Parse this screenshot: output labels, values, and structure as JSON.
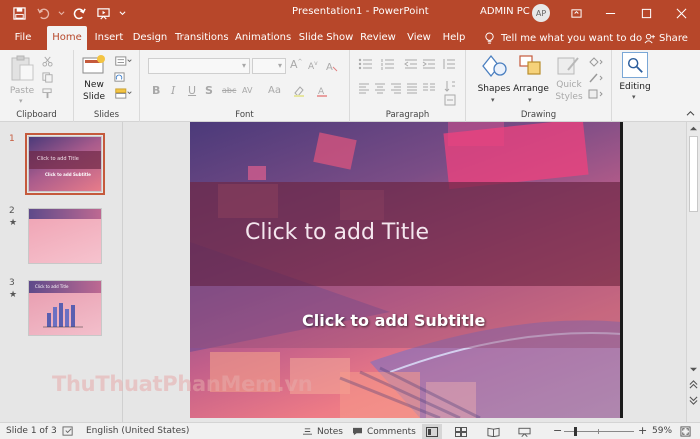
{
  "titlebar": {
    "title": "Presentation1 - PowerPoint",
    "user_name": "ADMIN PC",
    "avatar_initials": "AP"
  },
  "tabs": [
    {
      "label": "File"
    },
    {
      "label": "Home",
      "active": true
    },
    {
      "label": "Insert"
    },
    {
      "label": "Design"
    },
    {
      "label": "Transitions"
    },
    {
      "label": "Animations"
    },
    {
      "label": "Slide Show"
    },
    {
      "label": "Review"
    },
    {
      "label": "View"
    },
    {
      "label": "Help"
    }
  ],
  "tell_me": "Tell me what you want to do",
  "share": "Share",
  "ribbon": {
    "clipboard": {
      "label": "Clipboard",
      "paste": "Paste"
    },
    "slides": {
      "label": "Slides",
      "new_slide_1": "New",
      "new_slide_2": "Slide"
    },
    "font": {
      "label": "Font",
      "bold": "B",
      "italic": "I",
      "underline": "U",
      "shadow": "S",
      "strike": "abc",
      "spacing": "AV",
      "case": "Aa"
    },
    "paragraph": {
      "label": "Paragraph"
    },
    "drawing": {
      "label": "Drawing",
      "shapes": "Shapes",
      "arrange": "Arrange",
      "quick_1": "Quick",
      "quick_2": "Styles"
    },
    "editing": {
      "label": "Editing"
    }
  },
  "thumbnails": [
    {
      "number": "1",
      "title": "Click to add Title",
      "subtitle": "Click to add Subtitle"
    },
    {
      "number": "2",
      "star": "★"
    },
    {
      "number": "3",
      "star": "★",
      "title": "Click to add Title"
    }
  ],
  "slide": {
    "title": "Click to add Title",
    "subtitle": "Click to add Subtitle"
  },
  "status": {
    "slide_of": "Slide 1 of 3",
    "language": "English (United States)",
    "notes": "Notes",
    "comments": "Comments",
    "zoom": "59%"
  },
  "watermark": "ThuThuatPhanMem.vn",
  "colors": {
    "accent": "#b7472a"
  }
}
